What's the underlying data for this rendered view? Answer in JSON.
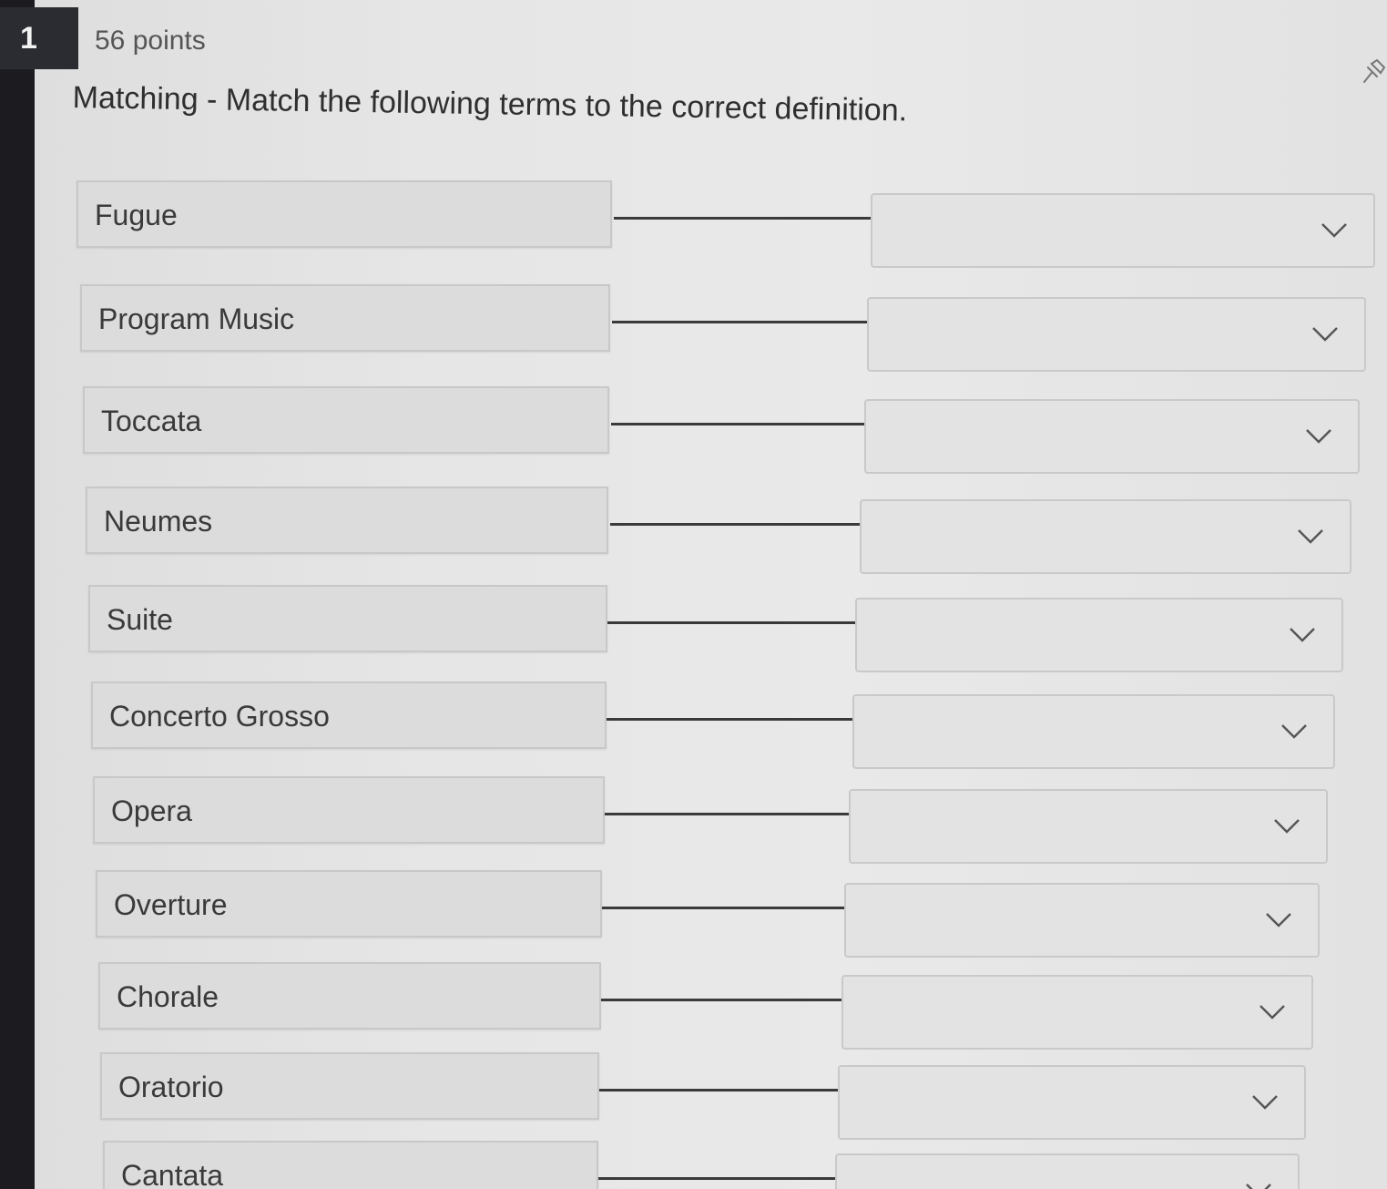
{
  "question": {
    "number": "1",
    "points": "56 points",
    "prompt": "Matching - Match the following terms to the correct definition."
  },
  "icons": {
    "pin": "pin-icon",
    "dropdown": "chevron-down-icon"
  },
  "terms": [
    {
      "label": "Fugue",
      "selected": ""
    },
    {
      "label": "Program Music",
      "selected": ""
    },
    {
      "label": "Toccata",
      "selected": ""
    },
    {
      "label": "Neumes",
      "selected": ""
    },
    {
      "label": "Suite",
      "selected": ""
    },
    {
      "label": "Concerto Grosso",
      "selected": ""
    },
    {
      "label": "Opera",
      "selected": ""
    },
    {
      "label": "Overture",
      "selected": ""
    },
    {
      "label": "Chorale",
      "selected": ""
    },
    {
      "label": "Oratorio",
      "selected": ""
    },
    {
      "label": "Cantata",
      "selected": ""
    }
  ]
}
